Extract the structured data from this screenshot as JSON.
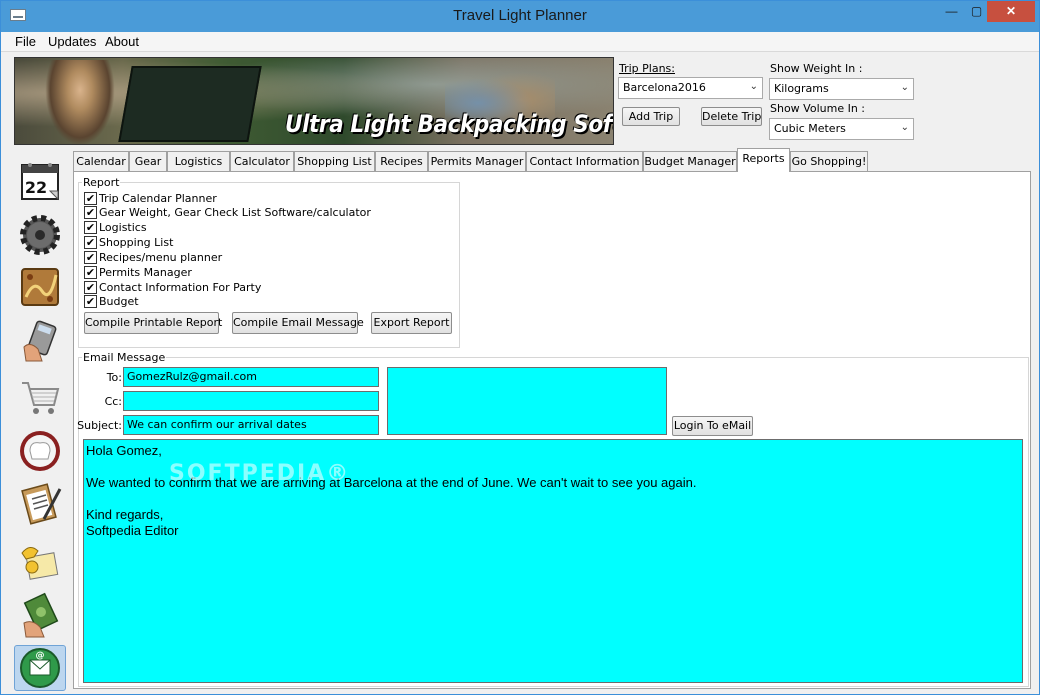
{
  "window": {
    "title": "Travel Light Planner",
    "controls": {
      "minimize": "—",
      "maximize": "▢",
      "close": "✕"
    }
  },
  "menu": {
    "items": [
      "File",
      "Updates",
      "About"
    ]
  },
  "banner": {
    "tagline": "Ultra Light Backpacking Software"
  },
  "trip": {
    "label": "Trip Plans:",
    "selected": "Barcelona2016",
    "add_label": "Add Trip",
    "delete_label": "Delete Trip"
  },
  "units": {
    "weight_label": "Show Weight In :",
    "weight_value": "Kilograms",
    "volume_label": "Show Volume In :",
    "volume_value": "Cubic Meters"
  },
  "sidebar": {
    "icons": [
      "calendar-icon",
      "gear-icon",
      "logistics-map-icon",
      "calculator-icon",
      "shopping-cart-icon",
      "recipes-chef-icon",
      "permits-clipboard-icon",
      "contact-phone-icon",
      "budget-money-icon",
      "email-report-icon"
    ],
    "calendar_day": "22"
  },
  "tabs": [
    "Calendar",
    "Gear",
    "Logistics",
    "Calculator",
    "Shopping List",
    "Recipes",
    "Permits Manager",
    "Contact Information",
    "Budget Manager",
    "Reports",
    "Go Shopping!"
  ],
  "active_tab": "Reports",
  "report": {
    "group_title": "Report",
    "checkboxes": [
      {
        "label": "Trip Calendar Planner",
        "checked": true
      },
      {
        "label": "Gear Weight, Gear Check List Software/calculator",
        "checked": true
      },
      {
        "label": "Logistics",
        "checked": true
      },
      {
        "label": "Shopping List",
        "checked": true
      },
      {
        "label": "Recipes/menu planner",
        "checked": true
      },
      {
        "label": "Permits Manager",
        "checked": true
      },
      {
        "label": "Contact Information For Party",
        "checked": true
      },
      {
        "label": "Budget",
        "checked": true
      }
    ],
    "check_mark": "✔",
    "compile_printable": "Compile Printable Report",
    "compile_email": "Compile Email Message",
    "export": "Export Report"
  },
  "email": {
    "group_title": "Email Message",
    "to_label": "To:",
    "to_value": "GomezRulz@gmail.com",
    "cc_label": "Cc:",
    "cc_value": "",
    "subject_label": "Subject:",
    "subject_value": "We can confirm our arrival dates",
    "login_label": "Login To eMail",
    "body": {
      "greeting": "Hola Gomez,",
      "line1": "We wanted to confirm that we are arriving at Barcelona at the end of June. We can't wait to see you again.",
      "closing": "Kind regards,",
      "signature": "Softpedia Editor"
    }
  },
  "watermark": "SOFTPEDIA®",
  "colors": {
    "titlebar": "#4a9bd8",
    "field_bg": "#00ffff",
    "close": "#c7503f"
  }
}
